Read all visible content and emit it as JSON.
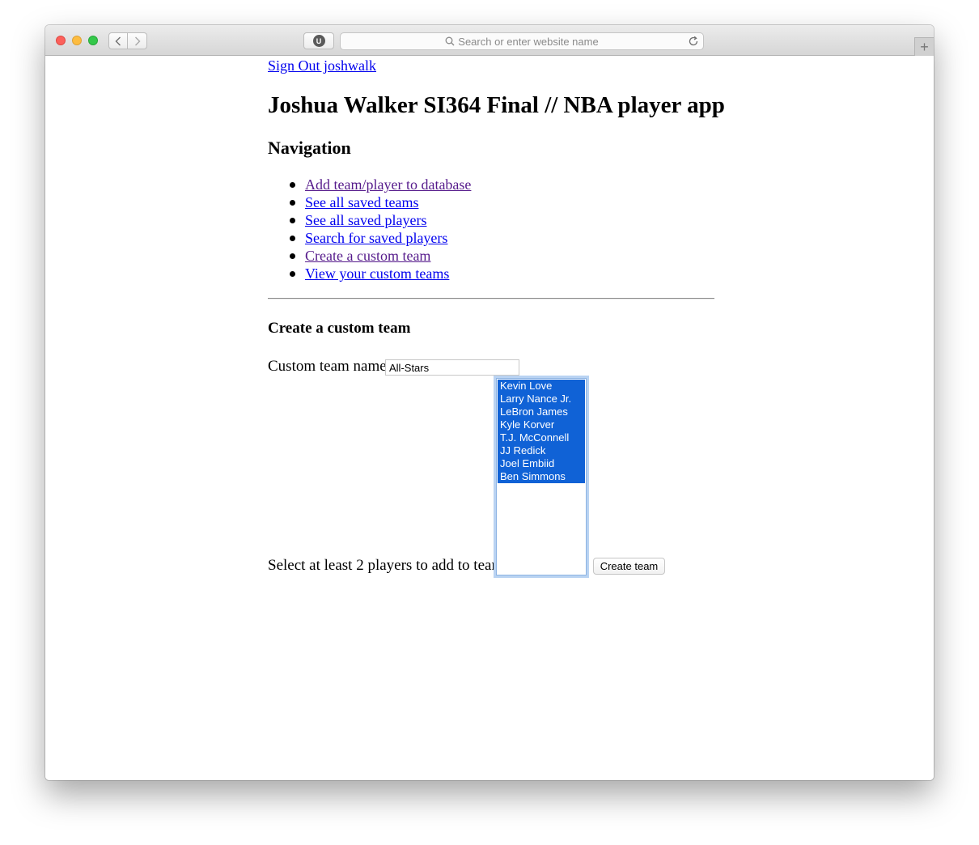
{
  "browser": {
    "address_placeholder": "Search or enter website name",
    "extension_label": "U",
    "new_tab_label": "+"
  },
  "page": {
    "signout_link": "Sign Out joshwalk",
    "title": "Joshua Walker SI364 Final // NBA player app",
    "nav_heading": "Navigation",
    "nav_items": [
      "Add team/player to database",
      "See all saved teams",
      "See all saved players",
      "Search for saved players",
      "Create a custom team",
      "View your custom teams"
    ],
    "form": {
      "heading": "Create a custom team",
      "name_label": "Custom team name",
      "name_value": "All-Stars",
      "select_label": "Select at least 2 players to add to team",
      "players": [
        "Kevin Love",
        "Larry Nance Jr.",
        "LeBron James",
        "Kyle Korver",
        "T.J. McConnell",
        "JJ Redick",
        "Joel Embiid",
        "Ben Simmons"
      ],
      "submit_label": "Create team"
    }
  },
  "colors": {
    "link": "#0000ee",
    "visited_link": "#551a8b",
    "selection": "#1062d6",
    "focus_ring": "#b9d3f2"
  },
  "icons": [
    "back-chevron-icon",
    "forward-chevron-icon",
    "extension-icon",
    "search-icon",
    "reload-icon"
  ]
}
